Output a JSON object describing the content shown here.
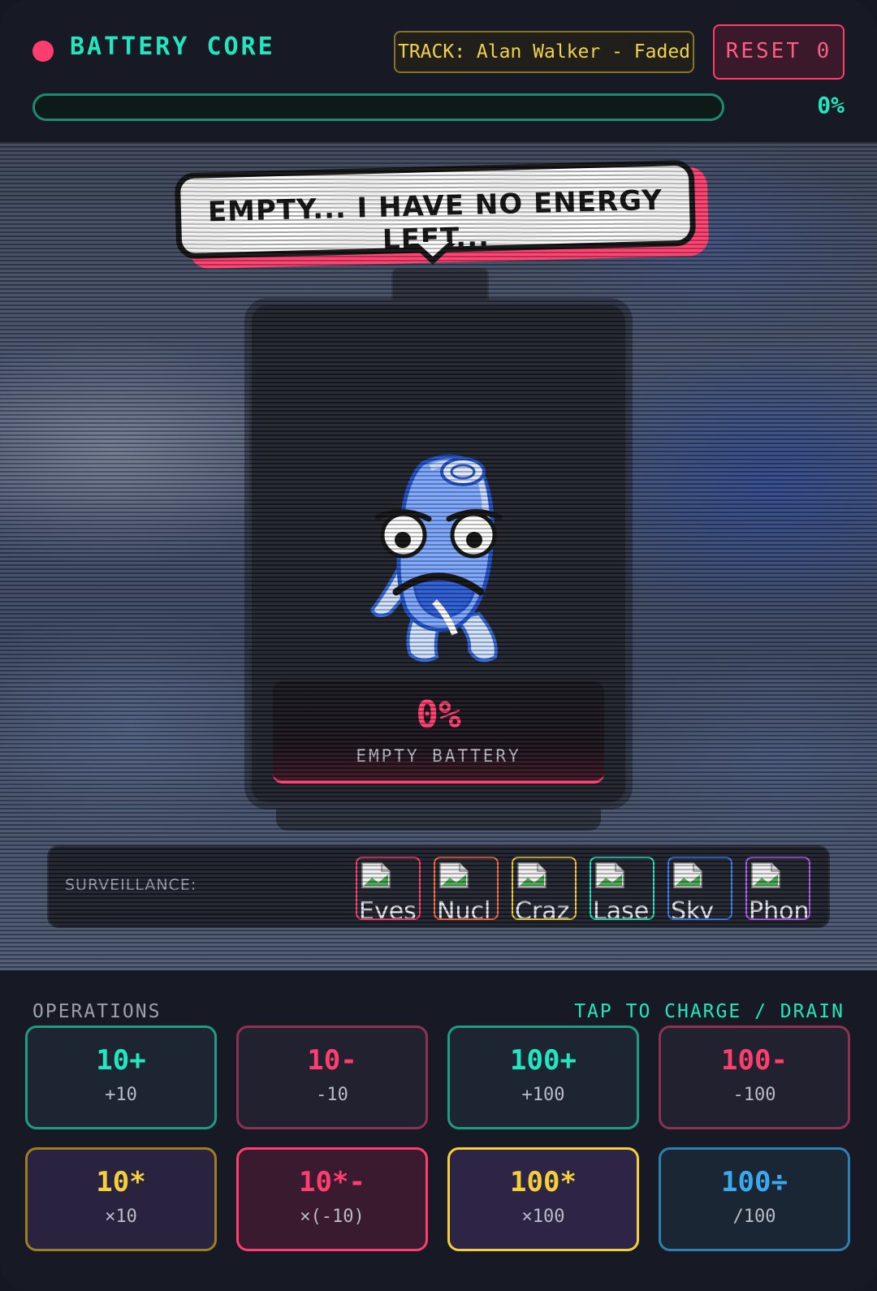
{
  "header": {
    "title": "BATTERY CORE",
    "track": "TRACK: Alan Walker - Faded",
    "reset_label": "RESET 0",
    "progress_percent_text": "0%",
    "progress_value": 0
  },
  "scene": {
    "speech": "EMPTY... I HAVE NO ENERGY LEFT...",
    "battery": {
      "percent_text": "0%",
      "status": "EMPTY BATTERY"
    },
    "surveillance": {
      "label": "SURVEILLANCE:",
      "cams": [
        {
          "label": "Eyes",
          "color": "#ff3d6e"
        },
        {
          "label": "Nucl",
          "color": "#ff6a3d"
        },
        {
          "label": "Craz",
          "color": "#f4cf3a"
        },
        {
          "label": "Lase",
          "color": "#22e6c0"
        },
        {
          "label": "Sky",
          "color": "#3a7cf0"
        },
        {
          "label": "Phon",
          "color": "#b05cf0"
        }
      ]
    }
  },
  "operations": {
    "title": "OPERATIONS",
    "hint": "TAP TO CHARGE / DRAIN",
    "buttons": [
      {
        "main": "10+",
        "sub": "+10"
      },
      {
        "main": "10-",
        "sub": "-10"
      },
      {
        "main": "100+",
        "sub": "+100"
      },
      {
        "main": "100-",
        "sub": "-100"
      },
      {
        "main": "10*",
        "sub": "×10"
      },
      {
        "main": "10*-",
        "sub": "×(-10)"
      },
      {
        "main": "100*",
        "sub": "×100"
      },
      {
        "main": "100÷",
        "sub": "/100"
      }
    ]
  },
  "colors": {
    "accent_teal": "#22e6c0",
    "accent_pink": "#ff3d6e",
    "accent_gold": "#f4cf3a",
    "accent_blue": "#3aa9f0"
  }
}
